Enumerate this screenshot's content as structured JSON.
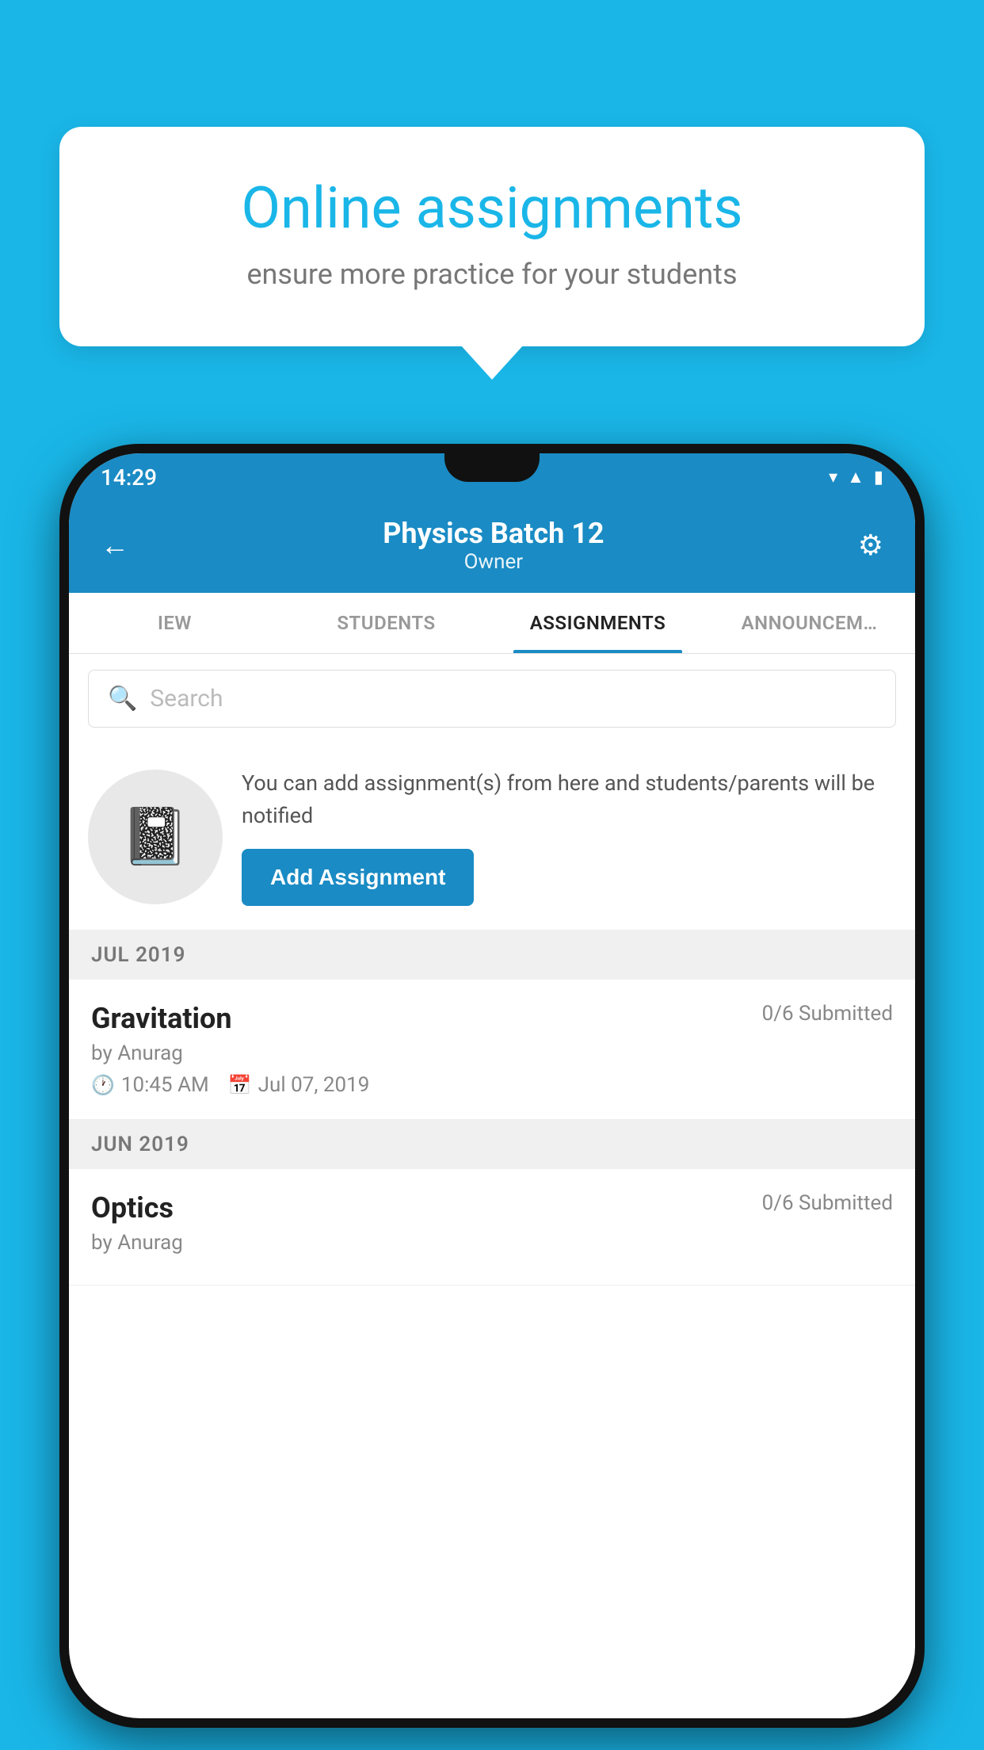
{
  "background_color": "#1ab6e8",
  "speech_bubble": {
    "title": "Online assignments",
    "subtitle": "ensure more practice for your students"
  },
  "phone": {
    "status_bar": {
      "time": "14:29",
      "icons": [
        "wifi",
        "signal",
        "battery"
      ]
    },
    "header": {
      "title": "Physics Batch 12",
      "subtitle": "Owner",
      "back_label": "←",
      "settings_label": "⚙"
    },
    "tabs": [
      {
        "label": "IEW",
        "active": false
      },
      {
        "label": "STUDENTS",
        "active": false
      },
      {
        "label": "ASSIGNMENTS",
        "active": true
      },
      {
        "label": "ANNOUNCEM…",
        "active": false
      }
    ],
    "search": {
      "placeholder": "Search"
    },
    "promo": {
      "icon": "📓",
      "text": "You can add assignment(s) from here and students/parents will be notified",
      "button_label": "Add Assignment"
    },
    "sections": [
      {
        "header": "JUL 2019",
        "items": [
          {
            "name": "Gravitation",
            "submitted": "0/6 Submitted",
            "by": "by Anurag",
            "time": "10:45 AM",
            "date": "Jul 07, 2019"
          }
        ]
      },
      {
        "header": "JUN 2019",
        "items": [
          {
            "name": "Optics",
            "submitted": "0/6 Submitted",
            "by": "by Anurag",
            "time": "",
            "date": ""
          }
        ]
      }
    ]
  }
}
